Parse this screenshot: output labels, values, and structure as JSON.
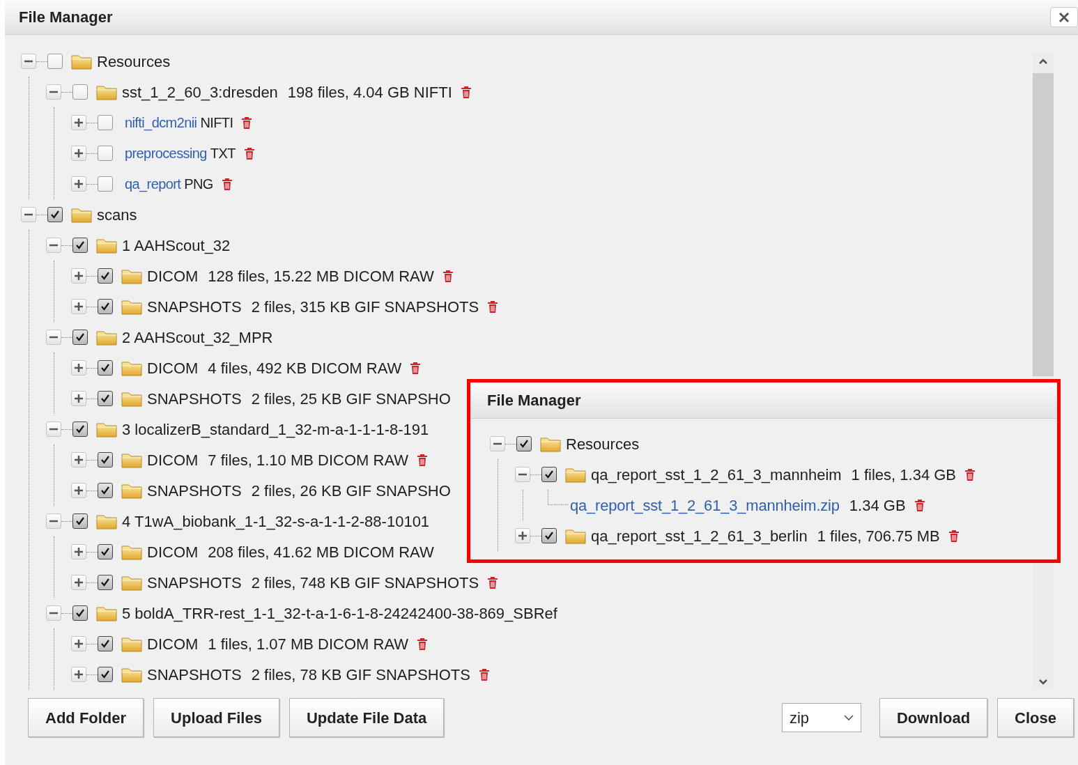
{
  "window": {
    "title": "File Manager"
  },
  "tree": [
    {
      "kind": "folder",
      "label": "Resources",
      "expanded": true,
      "checked": false,
      "trash": false,
      "children": [
        {
          "kind": "folder",
          "label": "sst_1_2_60_3:dresden",
          "detail": "198 files, 4.04 GB NIFTI",
          "expanded": true,
          "checked": false,
          "trash": true,
          "children": [
            {
              "kind": "link",
              "label": "nifti_dcm2nii",
              "detail": "NIFTI",
              "expanded": false,
              "checked": false,
              "trash": true
            },
            {
              "kind": "link",
              "label": "preprocessing",
              "detail": "TXT",
              "expanded": false,
              "checked": false,
              "trash": true
            },
            {
              "kind": "link",
              "label": "qa_report",
              "detail": "PNG",
              "expanded": false,
              "checked": false,
              "trash": true
            }
          ]
        }
      ]
    },
    {
      "kind": "folder",
      "label": "scans",
      "expanded": true,
      "checked": true,
      "trash": false,
      "children": [
        {
          "kind": "folder",
          "label": "1 AAHScout_32",
          "expanded": true,
          "checked": true,
          "trash": false,
          "children": [
            {
              "kind": "folder",
              "label": "DICOM",
              "detail": "128 files, 15.22 MB DICOM RAW",
              "expanded": false,
              "checked": true,
              "trash": true
            },
            {
              "kind": "folder",
              "label": "SNAPSHOTS",
              "detail": "2 files, 315 KB GIF SNAPSHOTS",
              "expanded": false,
              "checked": true,
              "trash": true
            }
          ]
        },
        {
          "kind": "folder",
          "label": "2 AAHScout_32_MPR",
          "expanded": true,
          "checked": true,
          "trash": false,
          "children": [
            {
              "kind": "folder",
              "label": "DICOM",
              "detail": "4 files, 492 KB DICOM RAW",
              "expanded": false,
              "checked": true,
              "trash": true
            },
            {
              "kind": "folder",
              "label": "SNAPSHOTS",
              "detail": "2 files, 25 KB GIF SNAPSHO",
              "expanded": false,
              "checked": true,
              "trash": false
            }
          ]
        },
        {
          "kind": "folder",
          "label": "3 localizerB_standard_1_32-m-a-1-1-1-8-191",
          "expanded": true,
          "checked": true,
          "trash": false,
          "children": [
            {
              "kind": "folder",
              "label": "DICOM",
              "detail": "7 files, 1.10 MB DICOM RAW",
              "expanded": false,
              "checked": true,
              "trash": true
            },
            {
              "kind": "folder",
              "label": "SNAPSHOTS",
              "detail": "2 files, 26 KB GIF SNAPSHO",
              "expanded": false,
              "checked": true,
              "trash": false
            }
          ]
        },
        {
          "kind": "folder",
          "label": "4 T1wA_biobank_1-1_32-s-a-1-1-2-88-10101",
          "expanded": true,
          "checked": true,
          "trash": false,
          "children": [
            {
              "kind": "folder",
              "label": "DICOM",
              "detail": "208 files, 41.62 MB DICOM RAW",
              "expanded": false,
              "checked": true,
              "trash": false
            },
            {
              "kind": "folder",
              "label": "SNAPSHOTS",
              "detail": "2 files, 748 KB GIF SNAPSHOTS",
              "expanded": false,
              "checked": true,
              "trash": true
            }
          ]
        },
        {
          "kind": "folder",
          "label": "5 boldA_TRR-rest_1-1_32-t-a-1-6-1-8-24242400-38-869_SBRef",
          "expanded": true,
          "checked": true,
          "trash": false,
          "children": [
            {
              "kind": "folder",
              "label": "DICOM",
              "detail": "1 files, 1.07 MB DICOM RAW",
              "expanded": false,
              "checked": true,
              "trash": true
            },
            {
              "kind": "folder",
              "label": "SNAPSHOTS",
              "detail": "2 files, 78 KB GIF SNAPSHOTS",
              "expanded": false,
              "checked": true,
              "trash": true
            }
          ]
        }
      ]
    }
  ],
  "callout": {
    "title": "File Manager",
    "tree": [
      {
        "kind": "folder",
        "label": "Resources",
        "expanded": true,
        "checked": true,
        "trash": false,
        "children": [
          {
            "kind": "folder",
            "label": "qa_report_sst_1_2_61_3_mannheim",
            "detail": "1 files, 1.34 GB",
            "expanded": true,
            "checked": true,
            "trash": true,
            "children": [
              {
                "kind": "file",
                "label": "qa_report_sst_1_2_61_3_mannheim.zip",
                "detail": "1.34 GB",
                "trash": true
              }
            ]
          },
          {
            "kind": "folder",
            "label": "qa_report_sst_1_2_61_3_berlin",
            "detail": "1 files, 706.75 MB",
            "expanded": false,
            "checked": true,
            "trash": true
          }
        ]
      }
    ]
  },
  "buttons_left": [
    "Add Folder",
    "Upload Files",
    "Update File Data"
  ],
  "format_select": {
    "value": "zip"
  },
  "buttons_right": [
    "Download",
    "Close"
  ]
}
